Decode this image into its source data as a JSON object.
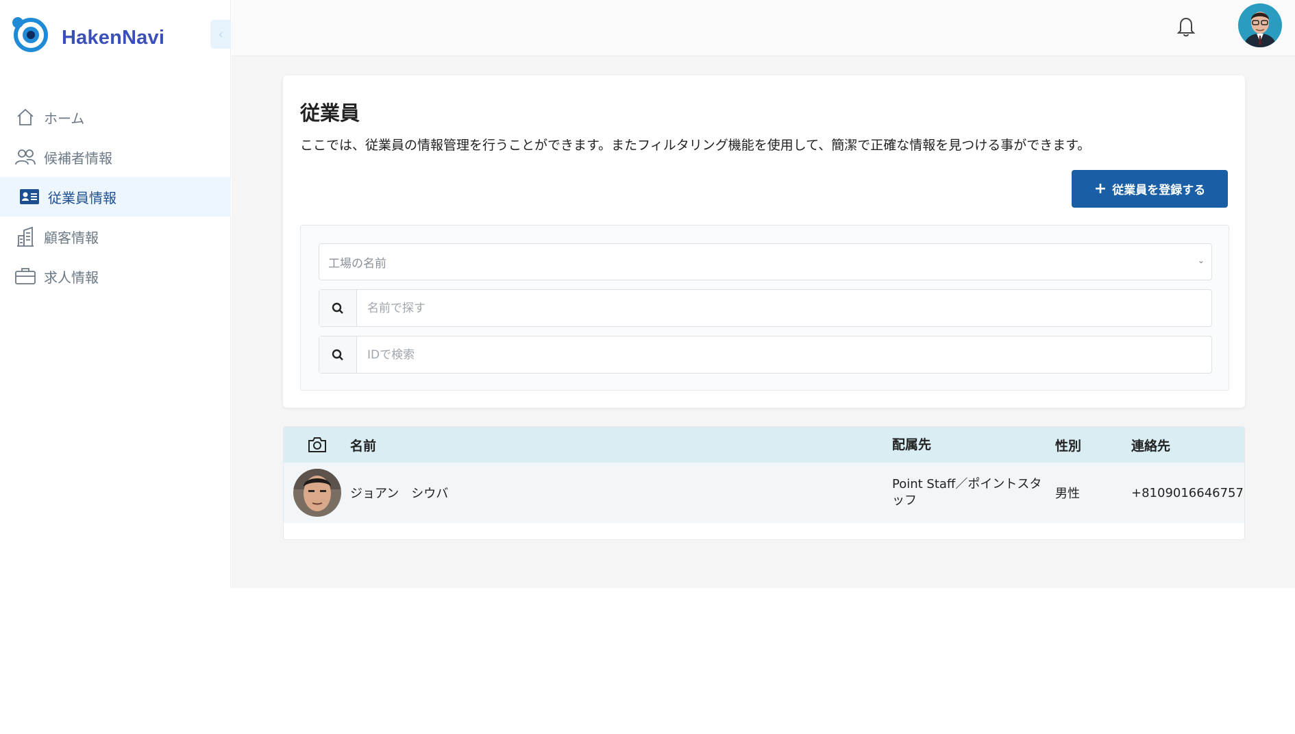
{
  "app": {
    "brand": "HakenNavi",
    "collapse_glyph": "‹"
  },
  "colors": {
    "brand": "#3b4fb8",
    "primary_button": "#1a5ea6",
    "active_nav_bg": "#eef6fd",
    "table_header_bg": "#d9edf2"
  },
  "sidebar": {
    "items": [
      {
        "label": "ホーム",
        "icon": "home-icon",
        "active": false
      },
      {
        "label": "候補者情報",
        "icon": "users-icon",
        "active": false
      },
      {
        "label": "従業員情報",
        "icon": "id-card-icon",
        "active": true
      },
      {
        "label": "顧客情報",
        "icon": "building-icon",
        "active": false
      },
      {
        "label": "求人情報",
        "icon": "briefcase-icon",
        "active": false
      }
    ]
  },
  "header": {
    "notification_icon": "bell-icon",
    "avatar_icon": "user-avatar"
  },
  "page": {
    "title": "従業員",
    "description": "ここでは、従業員の情報管理を行うことができます。またフィルタリング機能を使用して、簡潔で正確な情報を見つける事ができます。",
    "register_button": {
      "icon": "+",
      "label": "従業員を登録する"
    }
  },
  "filters": {
    "factory_select": {
      "placeholder": "工場の名前",
      "chevron": "⌄"
    },
    "name_search": {
      "placeholder": "名前で探す"
    },
    "id_search": {
      "placeholder": "IDで検索"
    }
  },
  "table": {
    "columns": {
      "photo_icon": "camera-icon",
      "name": "名前",
      "department": "配属先",
      "gender": "性別",
      "contact": "連絡先"
    },
    "rows": [
      {
        "name": "ジョアン　シウバ",
        "department": "Point Staff／ポイントスタッフ",
        "gender": "男性",
        "contact": "+8109016646757"
      }
    ]
  }
}
